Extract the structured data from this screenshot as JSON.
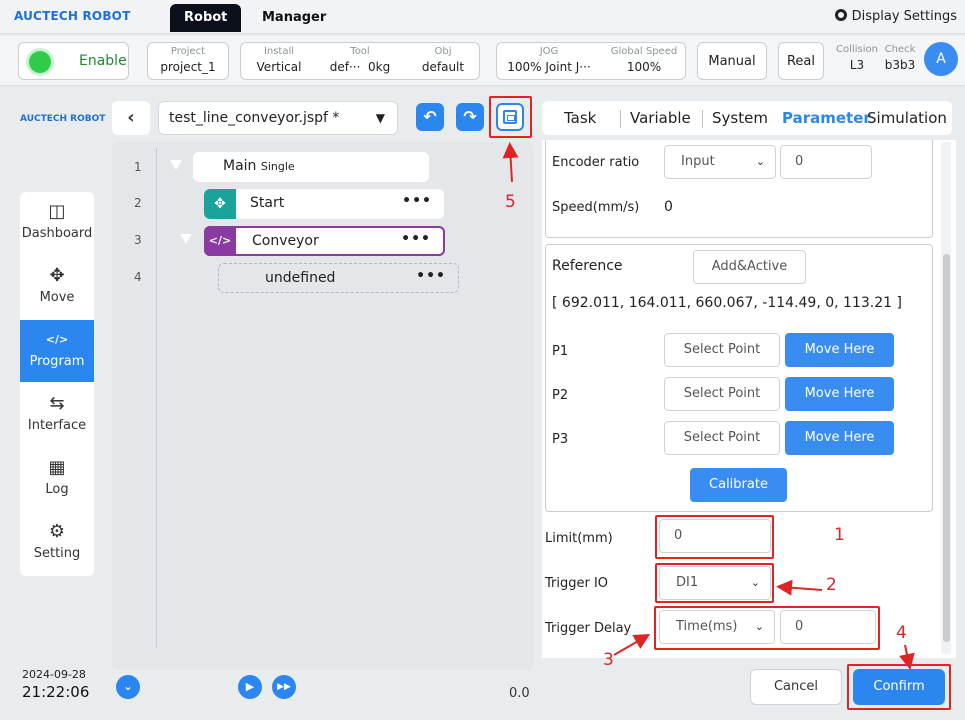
{
  "topbar": {
    "brand": "AUCTECH ROBOT",
    "tab_robot": "Robot",
    "tab_manager": "Manager",
    "display_settings": "Display Settings"
  },
  "status": {
    "enable": "Enable",
    "project_label": "Project",
    "project_value": "project_1",
    "install_label": "Install",
    "install_value": "Vertical",
    "tool_label": "Tool",
    "tool_value_a": "def···",
    "tool_value_b": "0kg",
    "obj_label": "Obj",
    "obj_value": "default",
    "jog_label": "JOG",
    "jog_value": "100% Joint J···",
    "global_speed_label": "Global Speed",
    "global_speed_value": "100%",
    "manual": "Manual",
    "real": "Real",
    "collision_label": "Collision",
    "collision_value": "L3",
    "check_label": "Check",
    "check_value": "b3b3",
    "avatar": "A"
  },
  "sidebar": {
    "brand": "AUCTECH ROBOT",
    "items": [
      {
        "label": "Dashboard",
        "icon": "monitor-icon"
      },
      {
        "label": "Move",
        "icon": "move-arrows-icon"
      },
      {
        "label": "Program",
        "icon": "code-icon"
      },
      {
        "label": "Interface",
        "icon": "swap-icon"
      },
      {
        "label": "Log",
        "icon": "calendar-icon"
      },
      {
        "label": "Setting",
        "icon": "gear-icon"
      }
    ],
    "date": "2024-09-28",
    "time": "21:22:06"
  },
  "program": {
    "filename": "test_line_conveyor.jspf *",
    "line_numbers": [
      "1",
      "2",
      "3",
      "4"
    ],
    "nodes": {
      "main": "Main",
      "main_suffix": "Single",
      "start": "Start",
      "conveyor": "Conveyor",
      "undefined": "undefined"
    },
    "speed_value": "0.0"
  },
  "right_tabs": [
    "Task",
    "Variable",
    "System",
    "Parameter",
    "Simulation"
  ],
  "active_right_tab": "Parameter",
  "params": {
    "encoder_ratio_label": "Encoder ratio",
    "encoder_ratio_mode": "Input",
    "encoder_ratio_value": "0",
    "speed_label": "Speed(mm/s)",
    "speed_value": "0",
    "reference_label": "Reference",
    "add_active": "Add&Active",
    "reference_values": "[ 692.011, 164.011, 660.067, -114.49, 0, 113.21 ]",
    "points": [
      {
        "label": "P1",
        "select": "Select Point",
        "move": "Move Here"
      },
      {
        "label": "P2",
        "select": "Select Point",
        "move": "Move Here"
      },
      {
        "label": "P3",
        "select": "Select Point",
        "move": "Move Here"
      }
    ],
    "calibrate": "Calibrate",
    "limit_label": "Limit(mm)",
    "limit_value": "0",
    "trigger_io_label": "Trigger IO",
    "trigger_io_value": "DI1",
    "trigger_delay_label": "Trigger Delay",
    "trigger_delay_mode": "Time(ms)",
    "trigger_delay_value": "0"
  },
  "actions": {
    "cancel": "Cancel",
    "confirm": "Confirm"
  },
  "annotations": [
    "1",
    "2",
    "3",
    "4",
    "5"
  ],
  "colors": {
    "accent": "#2b86ef",
    "annotation": "#e02424",
    "enable_green": "#2ecc48",
    "conveyor_purple": "#8a3aa0",
    "start_teal": "#1aa39a"
  }
}
